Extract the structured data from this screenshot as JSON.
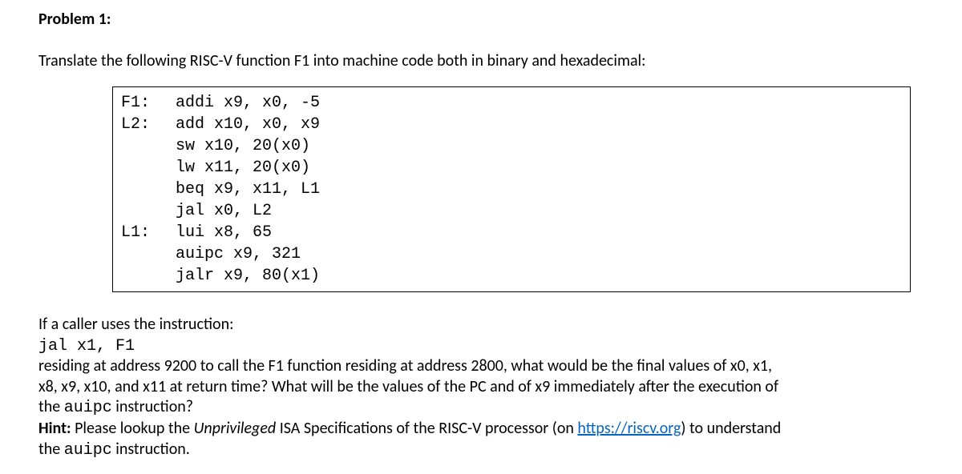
{
  "title": "Problem 1:",
  "intro": "Translate the following RISC-V function F1 into machine code both in binary and hexadecimal:",
  "code": [
    {
      "label": "F1:",
      "instr": "addi x9, x0, -5"
    },
    {
      "label": "L2:",
      "instr": "add x10, x0, x9"
    },
    {
      "label": "",
      "instr": "sw x10, 20(x0)"
    },
    {
      "label": "",
      "instr": "lw x11, 20(x0)"
    },
    {
      "label": "",
      "instr": "beq x9, x11, L1"
    },
    {
      "label": "",
      "instr": "jal x0, L2"
    },
    {
      "label": "L1:",
      "instr": "lui x8, 65"
    },
    {
      "label": "",
      "instr": "auipc x9, 321"
    },
    {
      "label": "",
      "instr": "jalr x9, 80(x1)"
    }
  ],
  "q_line1": "If a caller uses the instruction:",
  "q_jal": "jal x1, F1",
  "q_line2a": "residing at address 9200 to call the F1 function residing at address 2800, what would be the final values of x0, x1,",
  "q_line2b": "x8, x9, x10, and x11 at return time? What will be the values of the PC and of x9 immediately after the execution of",
  "q_line2c_prefix": "the ",
  "q_line2c_mono": "auipc",
  "q_line2c_suffix": " instruction?",
  "hint_label": "Hint: ",
  "hint_text1": "Please lookup the ",
  "hint_italic": "Unprivileged",
  "hint_text2": " ISA Specifications of the RISC-V processor (on ",
  "hint_link": "https://riscv.org",
  "hint_text3": ") to understand",
  "hint_line2_prefix": "the ",
  "hint_line2_mono": "auipc",
  "hint_line2_suffix": " instruction."
}
